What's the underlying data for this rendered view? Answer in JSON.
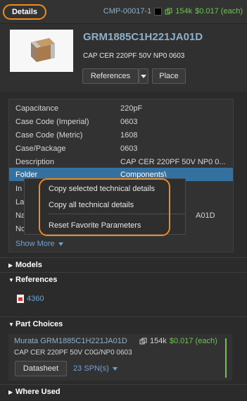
{
  "header": {
    "tab_label": "Details",
    "component_id": "CMP-00017-1",
    "stock": "154k",
    "price": "$0.017 (each)"
  },
  "summary": {
    "part_number": "GRM1885C1H221JA01D",
    "description": "CAP CER 220PF 50V NP0 0603",
    "references_button": "References",
    "place_button": "Place"
  },
  "parameters": [
    {
      "name": "Capacitance",
      "value": "220pF"
    },
    {
      "name": "Case Code (Imperial)",
      "value": "0603"
    },
    {
      "name": "Case Code (Metric)",
      "value": "1608"
    },
    {
      "name": "Case/Package",
      "value": "0603"
    },
    {
      "name": "Description",
      "value": "CAP CER 220PF 50V NP0 0..."
    },
    {
      "name": "Folder",
      "value": "Components\\"
    },
    {
      "name": "In",
      "value": ""
    },
    {
      "name": "La",
      "value": ""
    },
    {
      "name": "Na",
      "value": "A01D"
    },
    {
      "name": "No",
      "value": ""
    }
  ],
  "show_more": "Show More",
  "context_menu": {
    "items": [
      "Copy selected technical details",
      "Copy all technical details",
      "Reset Favorite Parameters"
    ]
  },
  "sections": {
    "models": "Models",
    "references": "References",
    "part_choices": "Part Choices",
    "where_used": "Where Used"
  },
  "references_list": [
    "4360"
  ],
  "part_choice": {
    "title": "Murata GRM1885C1H221JA01D",
    "stock": "154k",
    "price": "$0.017 (each)",
    "description": "CAP CER 220PF 50V C0G/NP0 0603",
    "datasheet_button": "Datasheet",
    "spn": "23 SPN(s)"
  },
  "colors": {
    "accent_highlight": "#f28a1c",
    "selection": "#35719f",
    "link": "#6fa3d6",
    "in_stock": "#6fc34e"
  }
}
